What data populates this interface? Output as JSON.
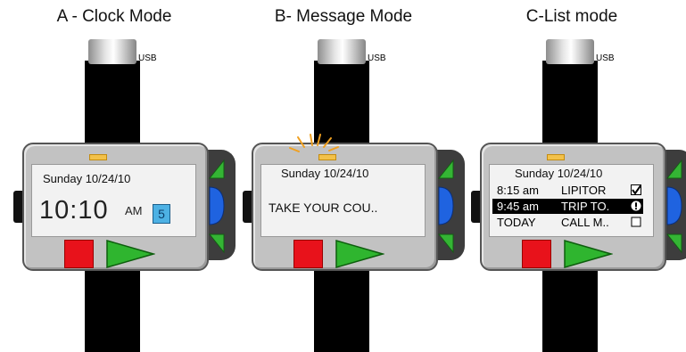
{
  "panels": [
    {
      "title": "A - Clock Mode",
      "usb_label": "USB",
      "screen": {
        "date": "Sunday 10/24/10",
        "time": "10:10",
        "ampm": "AM",
        "badge": "5"
      }
    },
    {
      "title": "B- Message Mode",
      "usb_label": "USB",
      "screen": {
        "date": "Sunday 10/24/10",
        "message": "TAKE YOUR COU.."
      }
    },
    {
      "title": "C-List mode",
      "usb_label": "USB",
      "screen": {
        "date": "Sunday 10/24/10",
        "rows": [
          {
            "time": "8:15 am",
            "task": "LIPITOR",
            "mark": "checkbox-checked"
          },
          {
            "time": "9:45 am",
            "task": "TRIP TO.",
            "mark": "alert-circle",
            "selected": true
          },
          {
            "time": "TODAY",
            "task": "CALL M..",
            "mark": "checkbox-empty"
          }
        ]
      }
    }
  ],
  "colors": {
    "case": "#c2c2c2",
    "screen": "#f2f2f2",
    "strap": "#000000",
    "stop_button": "#e8121b",
    "play_button": "#2fb52f",
    "side_arrow": "#34b534",
    "side_center": "#1f63e0",
    "notification": "#f0a020",
    "indicator": "#f2c14a",
    "badge": "#4db1e4"
  }
}
